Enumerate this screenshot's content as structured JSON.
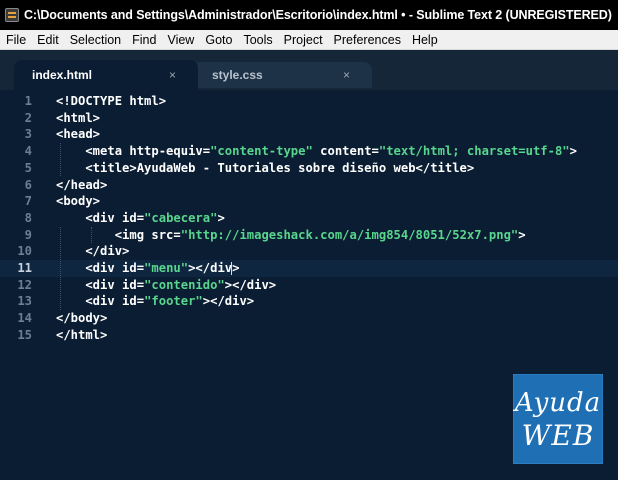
{
  "window": {
    "title": "C:\\Documents and Settings\\Administrador\\Escritorio\\index.html • - Sublime Text 2 (UNREGISTERED)"
  },
  "menu": {
    "items": [
      "File",
      "Edit",
      "Selection",
      "Find",
      "View",
      "Goto",
      "Tools",
      "Project",
      "Preferences",
      "Help"
    ]
  },
  "tabs": [
    {
      "label": "index.html",
      "active": true,
      "close": "×"
    },
    {
      "label": "style.css",
      "active": false,
      "close": "×"
    }
  ],
  "editor": {
    "current_line": 11,
    "lines": [
      {
        "n": "1",
        "text": "<!DOCTYPE html>"
      },
      {
        "n": "2",
        "text": "<html>"
      },
      {
        "n": "3",
        "text": "<head>"
      },
      {
        "n": "4",
        "text": "    <meta http-equiv=\"content-type\" content=\"text/html; charset=utf-8\">"
      },
      {
        "n": "5",
        "text": "    <title>AyudaWeb - Tutoriales sobre diseño web</title>"
      },
      {
        "n": "6",
        "text": "</head>"
      },
      {
        "n": "7",
        "text": "<body>"
      },
      {
        "n": "8",
        "text": "    <div id=\"cabecera\">"
      },
      {
        "n": "9",
        "text": "        <img src=\"http://imageshack.com/a/img854/8051/52x7.png\">"
      },
      {
        "n": "10",
        "text": "    </div>"
      },
      {
        "n": "11",
        "text": "    <div id=\"menu\"></div>"
      },
      {
        "n": "12",
        "text": "    <div id=\"contenido\"></div>"
      },
      {
        "n": "13",
        "text": "    <div id=\"footer\"></div>"
      },
      {
        "n": "14",
        "text": "</body>"
      },
      {
        "n": "15",
        "text": "</html>"
      }
    ]
  },
  "logo": {
    "line1": "Ayuda",
    "line2": "WEB"
  },
  "colors": {
    "editor_bg": "#0b1d33",
    "string": "#58d68d",
    "logo_bg": "#1f6fb4"
  }
}
